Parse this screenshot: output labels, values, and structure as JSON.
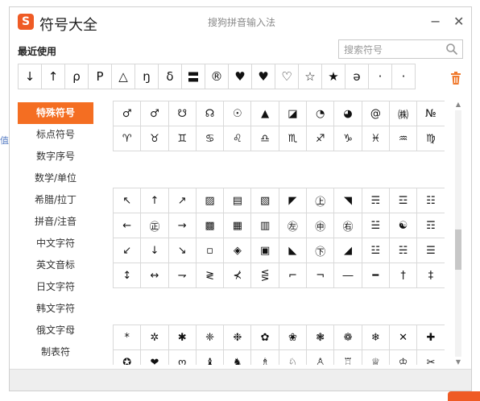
{
  "window": {
    "title": "符号大全",
    "logo_char": "S",
    "ime_name": "搜狗拼音输入法",
    "minimize_label": "−",
    "close_label": "✕"
  },
  "recent": {
    "label": "最近使用",
    "symbols": [
      "↓",
      "↑",
      "ρ",
      "Ρ",
      "△",
      "ŋ",
      "δ",
      "〓",
      "®",
      "♥",
      "♥",
      "♡",
      "☆",
      "★",
      "ə",
      "·",
      "·"
    ]
  },
  "search": {
    "placeholder": "搜索符号"
  },
  "sidebar": {
    "items": [
      {
        "label": "特殊符号",
        "active": true
      },
      {
        "label": "标点符号",
        "active": false
      },
      {
        "label": "数字序号",
        "active": false
      },
      {
        "label": "数学/单位",
        "active": false
      },
      {
        "label": "希腊/拉丁",
        "active": false
      },
      {
        "label": "拼音/注音",
        "active": false
      },
      {
        "label": "中文字符",
        "active": false
      },
      {
        "label": "英文音标",
        "active": false
      },
      {
        "label": "日文字符",
        "active": false
      },
      {
        "label": "韩文字符",
        "active": false
      },
      {
        "label": "俄文字母",
        "active": false
      },
      {
        "label": "制表符",
        "active": false
      }
    ]
  },
  "groups": [
    {
      "rows": [
        [
          "♂",
          "♂",
          "☋",
          "☊",
          "☉",
          "▲",
          "◪",
          "◔",
          "◕",
          "@",
          "㈱",
          "№"
        ],
        [
          "♈",
          "♉",
          "♊",
          "♋",
          "♌",
          "♎",
          "♏",
          "♐",
          "♑",
          "♓",
          "♒",
          "♍"
        ]
      ]
    },
    {
      "rows": [
        [
          "↖",
          "↑",
          "↗",
          "▨",
          "▤",
          "▧",
          "◤",
          "㊤",
          "◥",
          "☴",
          "☲",
          "☷"
        ],
        [
          "←",
          "㊣",
          "→",
          "▩",
          "▦",
          "▥",
          "㊧",
          "㊥",
          "㊨",
          "☱",
          "☯",
          "☶"
        ],
        [
          "↙",
          "↓",
          "↘",
          "▫",
          "◈",
          "▣",
          "◣",
          "㊦",
          "◢",
          "☳",
          "☵",
          "☰"
        ],
        [
          "↕",
          "↔",
          "⇁",
          "≷",
          "⊀",
          "⋚",
          "⌐",
          "¬",
          "―",
          "━",
          "†",
          "‡"
        ]
      ]
    },
    {
      "rows": [
        [
          "*",
          "✲",
          "✱",
          "❈",
          "❉",
          "✿",
          "❀",
          "❃",
          "❁",
          "❄",
          "✕",
          "✚"
        ],
        [
          "✪",
          "❤",
          "ო",
          "♝",
          "♞",
          "♗",
          "♘",
          "♙",
          "♖",
          "♕",
          "♔",
          "✂"
        ]
      ]
    }
  ],
  "scroll_position": 0.58,
  "left_edge_char": "值",
  "colors": {
    "accent": "#f46e22",
    "brand": "#ef5b25"
  },
  "icons": {
    "search": "search-icon",
    "trash": "trash-icon",
    "logo": "sogou-logo"
  }
}
